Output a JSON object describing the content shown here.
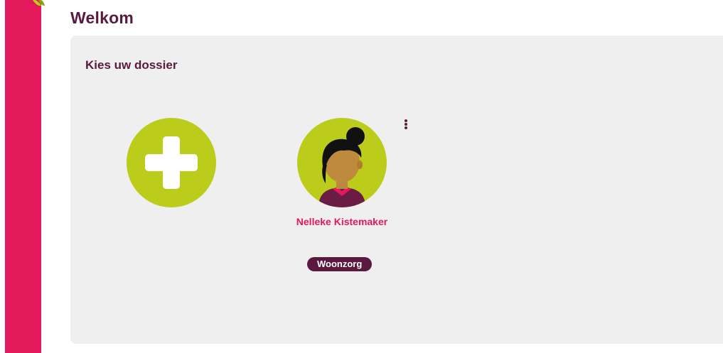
{
  "header": {
    "title": "Welkom"
  },
  "panel": {
    "title": "Kies uw dossier"
  },
  "add_dossier": {
    "icon": "plus-icon"
  },
  "dossiers": [
    {
      "name": "Nelleke Kistemaker",
      "badge": "Woonzorg",
      "avatar_icon": "woman-avatar-icon",
      "menu_icon": "more-vertical-icon"
    }
  ],
  "colors": {
    "sidebar": "#e2195a",
    "accent_green": "#bccc1a",
    "brand_purple": "#5a1a3f",
    "name_pink": "#e2195a",
    "panel_bg": "#efefef"
  }
}
